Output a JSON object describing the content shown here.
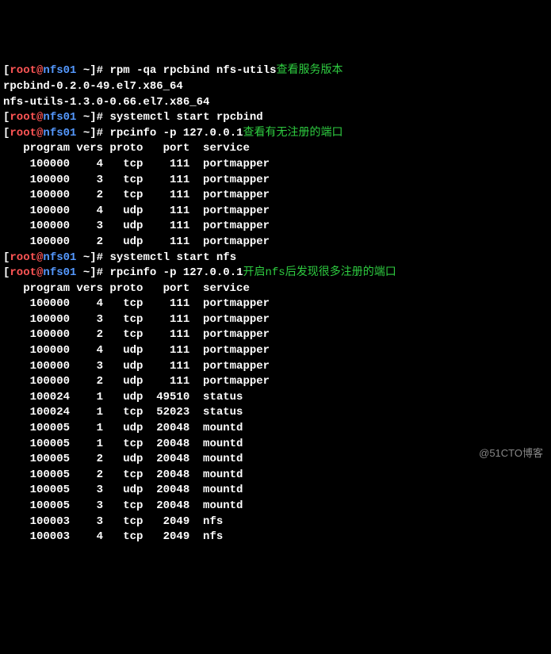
{
  "prompts": [
    {
      "user": "root",
      "host": "nfs01",
      "path": "~",
      "cmd": "rpm -qa rpcbind nfs-utils",
      "note": "查看服务版本"
    },
    {
      "user": "root",
      "host": "nfs01",
      "path": "~",
      "cmd": "systemctl start rpcbind",
      "note": ""
    },
    {
      "user": "root",
      "host": "nfs01",
      "path": "~",
      "cmd": "rpcinfo -p 127.0.0.1",
      "note": "查看有无注册的端口"
    },
    {
      "user": "root",
      "host": "nfs01",
      "path": "~",
      "cmd": "systemctl start nfs",
      "note": ""
    },
    {
      "user": "root",
      "host": "nfs01",
      "path": "~",
      "cmd": "rpcinfo -p 127.0.0.1",
      "note": "开启nfs后发现很多注册的端口"
    }
  ],
  "rpm_output": [
    "rpcbind-0.2.0-49.el7.x86_64",
    "nfs-utils-1.3.0-0.66.el7.x86_64"
  ],
  "rpcinfo_header": "   program vers proto   port  service",
  "rpcinfo1": [
    {
      "program": "100000",
      "vers": "4",
      "proto": "tcp",
      "port": "111",
      "service": "portmapper"
    },
    {
      "program": "100000",
      "vers": "3",
      "proto": "tcp",
      "port": "111",
      "service": "portmapper"
    },
    {
      "program": "100000",
      "vers": "2",
      "proto": "tcp",
      "port": "111",
      "service": "portmapper"
    },
    {
      "program": "100000",
      "vers": "4",
      "proto": "udp",
      "port": "111",
      "service": "portmapper"
    },
    {
      "program": "100000",
      "vers": "3",
      "proto": "udp",
      "port": "111",
      "service": "portmapper"
    },
    {
      "program": "100000",
      "vers": "2",
      "proto": "udp",
      "port": "111",
      "service": "portmapper"
    }
  ],
  "rpcinfo2": [
    {
      "program": "100000",
      "vers": "4",
      "proto": "tcp",
      "port": "111",
      "service": "portmapper"
    },
    {
      "program": "100000",
      "vers": "3",
      "proto": "tcp",
      "port": "111",
      "service": "portmapper"
    },
    {
      "program": "100000",
      "vers": "2",
      "proto": "tcp",
      "port": "111",
      "service": "portmapper"
    },
    {
      "program": "100000",
      "vers": "4",
      "proto": "udp",
      "port": "111",
      "service": "portmapper"
    },
    {
      "program": "100000",
      "vers": "3",
      "proto": "udp",
      "port": "111",
      "service": "portmapper"
    },
    {
      "program": "100000",
      "vers": "2",
      "proto": "udp",
      "port": "111",
      "service": "portmapper"
    },
    {
      "program": "100024",
      "vers": "1",
      "proto": "udp",
      "port": "49510",
      "service": "status"
    },
    {
      "program": "100024",
      "vers": "1",
      "proto": "tcp",
      "port": "52023",
      "service": "status"
    },
    {
      "program": "100005",
      "vers": "1",
      "proto": "udp",
      "port": "20048",
      "service": "mountd"
    },
    {
      "program": "100005",
      "vers": "1",
      "proto": "tcp",
      "port": "20048",
      "service": "mountd"
    },
    {
      "program": "100005",
      "vers": "2",
      "proto": "udp",
      "port": "20048",
      "service": "mountd"
    },
    {
      "program": "100005",
      "vers": "2",
      "proto": "tcp",
      "port": "20048",
      "service": "mountd"
    },
    {
      "program": "100005",
      "vers": "3",
      "proto": "udp",
      "port": "20048",
      "service": "mountd"
    },
    {
      "program": "100005",
      "vers": "3",
      "proto": "tcp",
      "port": "20048",
      "service": "mountd"
    },
    {
      "program": "100003",
      "vers": "3",
      "proto": "tcp",
      "port": "2049",
      "service": "nfs"
    },
    {
      "program": "100003",
      "vers": "4",
      "proto": "tcp",
      "port": "2049",
      "service": "nfs"
    }
  ],
  "watermark": "@51CTO博客"
}
